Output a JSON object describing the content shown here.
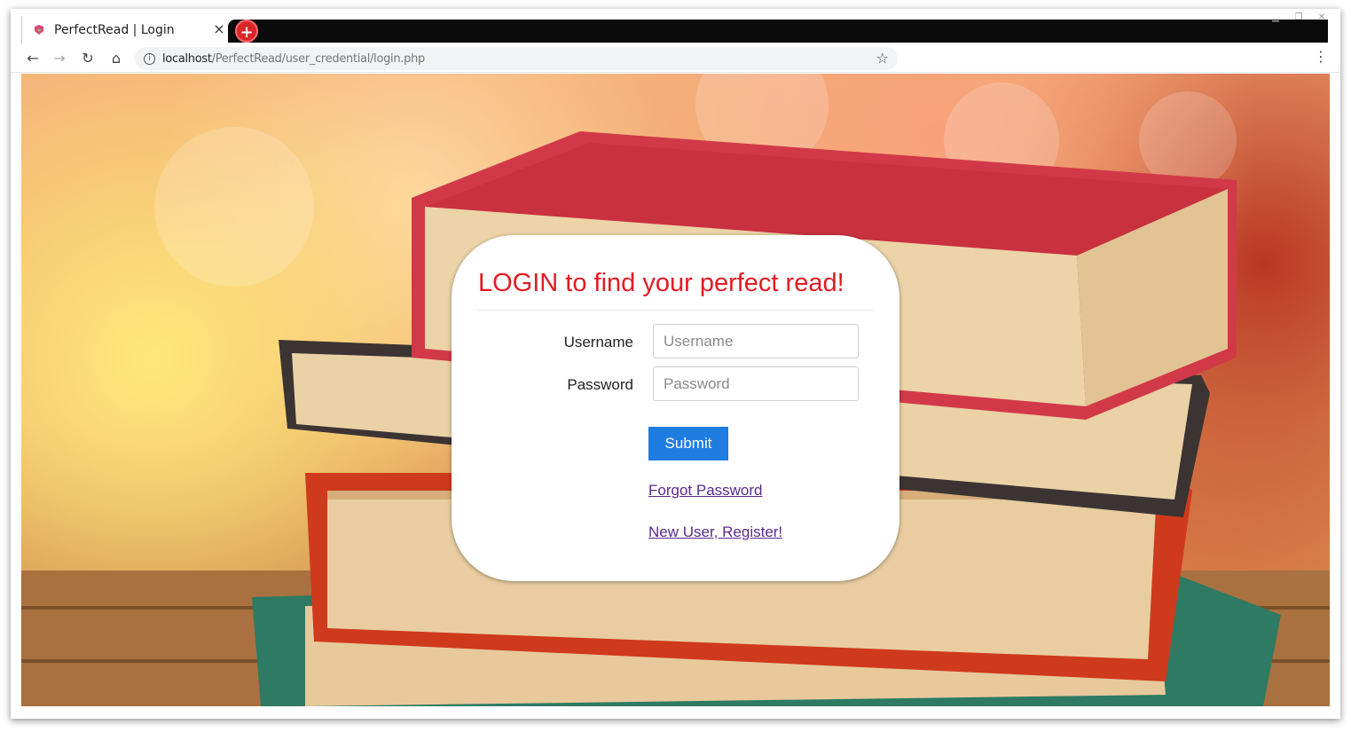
{
  "browser": {
    "tab_title": "PerfectRead | Login",
    "tab_close": "×",
    "new_tab": "+",
    "url_host": "localhost",
    "url_path": "/PerfectRead/user_credential/login.php",
    "icons": {
      "back": "back-arrow-icon",
      "forward": "forward-arrow-icon",
      "reload": "reload-icon",
      "home": "home-icon",
      "info": "info-icon",
      "bookmark": "star-icon",
      "menu": "kebab-menu-icon"
    }
  },
  "login": {
    "title": "LOGIN to find your perfect read!",
    "username_label": "Username",
    "username_placeholder": "Username",
    "password_label": "Password",
    "password_placeholder": "Password",
    "submit_label": "Submit",
    "forgot_link": "Forgot Password",
    "register_link": "New User, Register!"
  },
  "colors": {
    "title": "#e31b23",
    "submit": "#1e7de0",
    "link": "#5a2a8a"
  }
}
